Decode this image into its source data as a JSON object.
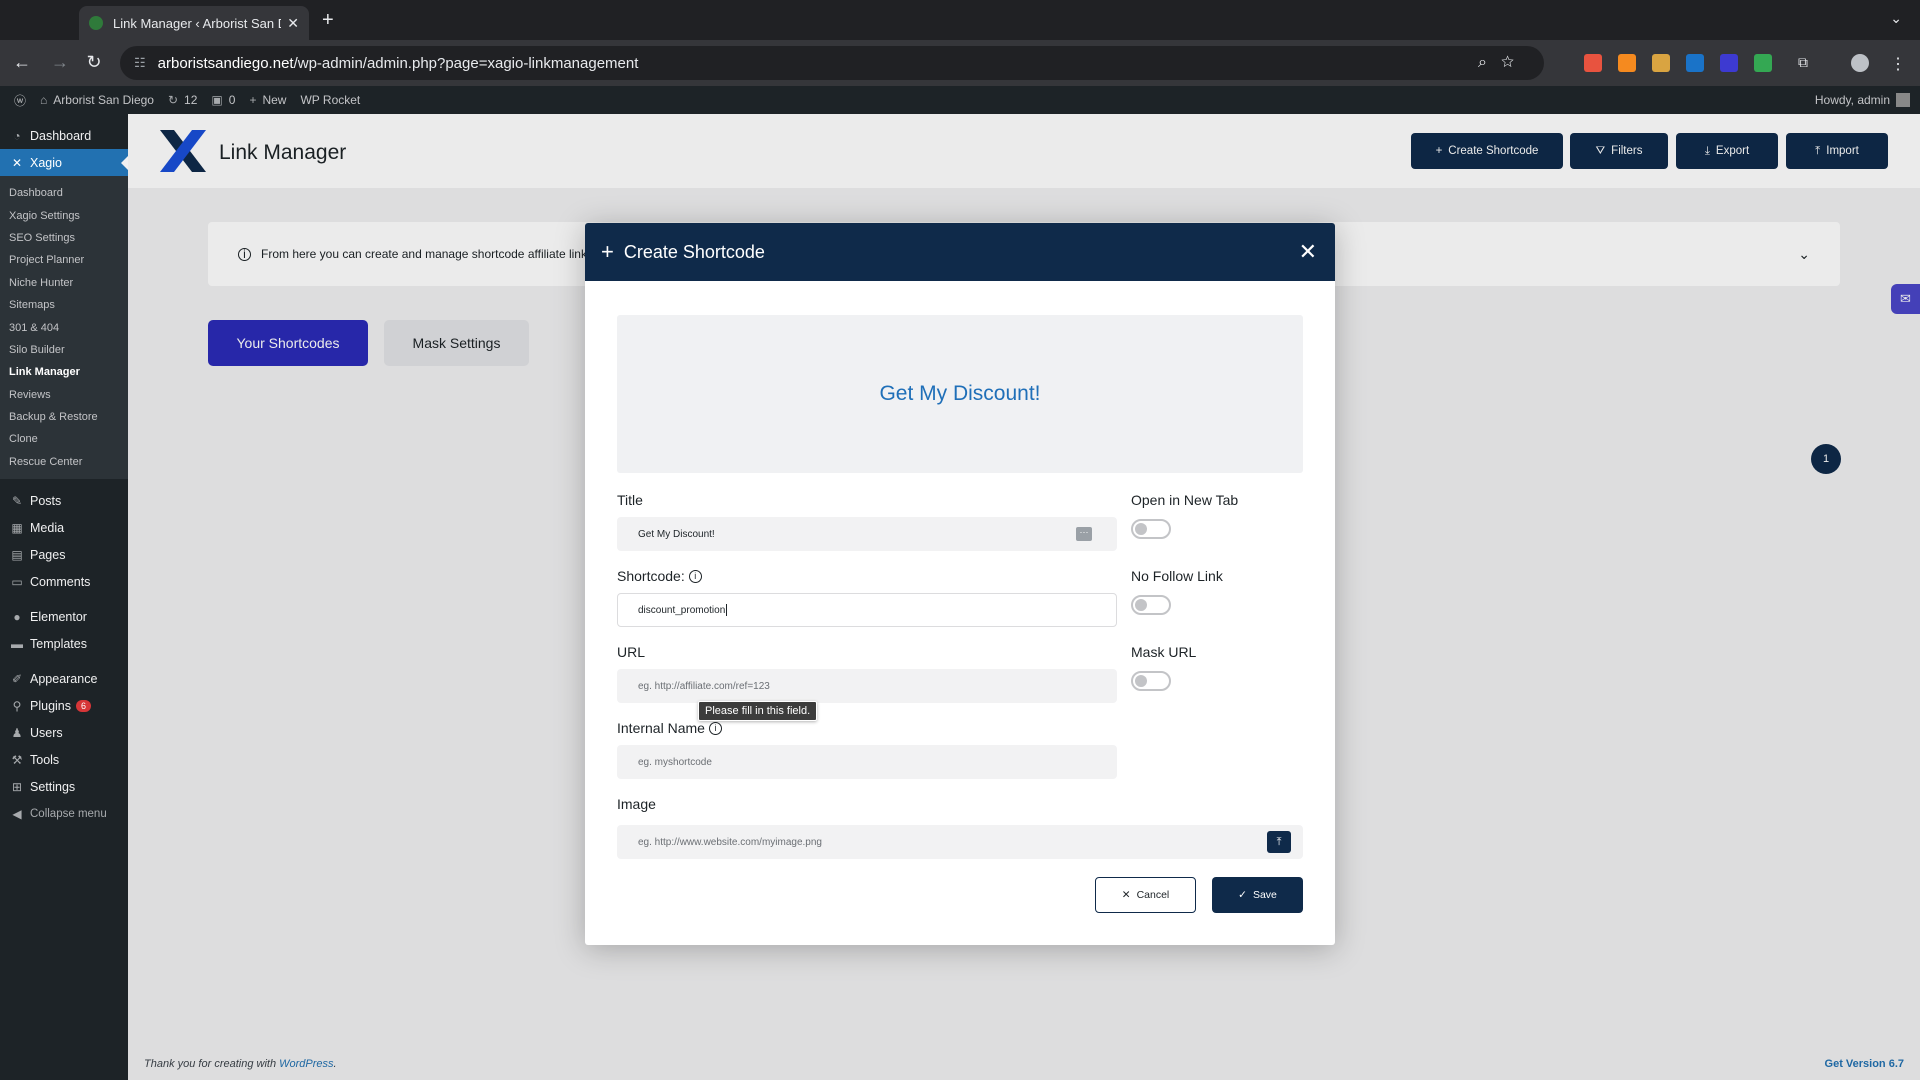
{
  "browser": {
    "tab_title": "Link Manager ‹ Arborist San D",
    "url_host": "arboristsandiego.net",
    "url_path": "/wp-admin/admin.php?page=xagio-linkmanagement"
  },
  "adminbar": {
    "site_name": "Arborist San Diego",
    "updates_count": "12",
    "comments_count": "0",
    "new_label": "New",
    "wp_rocket": "WP Rocket",
    "howdy": "Howdy, admin"
  },
  "sidebar": {
    "top_items": [
      {
        "label": "Dashboard",
        "icon": "dashboard-icon"
      },
      {
        "label": "Xagio",
        "icon": "xagio-icon"
      }
    ],
    "sub_items": [
      "Dashboard",
      "Xagio Settings",
      "SEO Settings",
      "Project Planner",
      "Niche Hunter",
      "Sitemaps",
      "301 & 404",
      "Silo Builder",
      "Link Manager",
      "Reviews",
      "Backup & Restore",
      "Clone",
      "Rescue Center"
    ],
    "items": [
      {
        "label": "Posts",
        "icon": "pin-icon"
      },
      {
        "label": "Media",
        "icon": "media-icon"
      },
      {
        "label": "Pages",
        "icon": "pages-icon"
      },
      {
        "label": "Comments",
        "icon": "comments-icon"
      },
      {
        "label": "Elementor",
        "icon": "elementor-icon"
      },
      {
        "label": "Templates",
        "icon": "folder-icon"
      },
      {
        "label": "Appearance",
        "icon": "brush-icon"
      },
      {
        "label": "Plugins",
        "icon": "plugin-icon",
        "badge": "6"
      },
      {
        "label": "Users",
        "icon": "users-icon"
      },
      {
        "label": "Tools",
        "icon": "wrench-icon"
      },
      {
        "label": "Settings",
        "icon": "settings-icon"
      },
      {
        "label": "Collapse menu",
        "icon": "collapse-icon"
      }
    ]
  },
  "header": {
    "logo_text": "Link Manager",
    "buttons": {
      "create": "Create Shortcode",
      "filters": "Filters",
      "export": "Export",
      "import": "Import"
    }
  },
  "notice": {
    "text": "From here you can create and manage shortcode affiliate links"
  },
  "tabs": {
    "shortcodes": "Your Shortcodes",
    "mask": "Mask Settings"
  },
  "pagination": {
    "current": "1"
  },
  "footer": {
    "thanks_prefix": "Thank you for creating with ",
    "wordpress": "WordPress",
    "period": ".",
    "version": "Get Version 6.7"
  },
  "modal": {
    "title": "Create Shortcode",
    "preview_text": "Get My Discount!",
    "fields": {
      "title_label": "Title",
      "title_value": "Get My Discount!",
      "shortcode_label": "Shortcode:",
      "shortcode_value": "discount_promotion",
      "url_label": "URL",
      "url_placeholder": "eg. http://affiliate.com/ref=123",
      "internal_label": "Internal Name",
      "internal_placeholder": "eg. myshortcode",
      "image_label": "Image",
      "image_placeholder": "eg. http://www.website.com/myimage.png"
    },
    "toggles": {
      "new_tab": {
        "label": "Open in New Tab",
        "on": false
      },
      "nofollow": {
        "label": "No Follow Link",
        "on": false
      },
      "mask": {
        "label": "Mask URL",
        "on": false
      }
    },
    "tooltip": "Please fill in this field.",
    "cancel": "Cancel",
    "save": "Save"
  },
  "colors": {
    "accent_navy": "#0f2a4a",
    "wp_blue": "#2271b1",
    "tab_active": "#2b2bb8",
    "preview_link": "#1f6fb8"
  }
}
